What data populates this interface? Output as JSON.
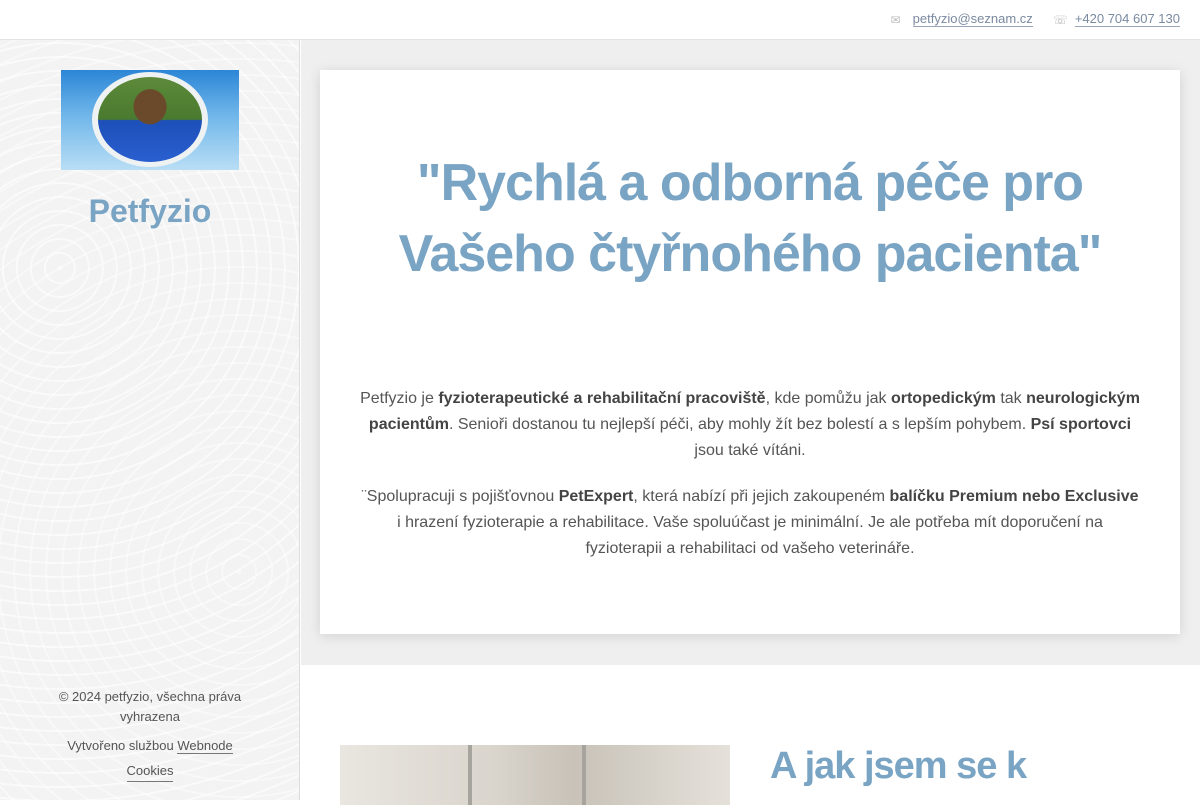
{
  "topbar": {
    "email": "petfyzio@seznam.cz",
    "phone": "+420 704 607 130",
    "email_icon": "envelope-icon",
    "phone_icon": "phone-icon"
  },
  "sidebar": {
    "site_title": "Petfyzio",
    "copyright": "© 2024 petfyzio, všechna práva vyhrazena",
    "made_with_prefix": "Vytvořeno službou",
    "made_with_link": "Webnode",
    "cookies": "Cookies"
  },
  "hero": {
    "headline": "\"Rychlá a odborná péče pro Vašeho čtyřnohého pacienta\""
  },
  "intro": {
    "p1": [
      "Petfyzio je ",
      "fyzioterapeutické a rehabilitační pracoviště",
      ", kde pomůžu jak ",
      "ortopedickým",
      " tak ",
      "neurologickým pacientům",
      ". Senioři dostanou tu nejlepší péči, aby mohly žít bez bolestí a s lepším pohybem. ",
      "Psí sportovci",
      " jsou také vítáni."
    ],
    "p2": [
      "¨Spolupracuji s pojišťovnou ",
      "PetExpert",
      ", která nabízí při jejich zakoupeném ",
      "balíčku Premium nebo Exclusive",
      " i hrazení fyzioterapie a rehabilitace. Vaše spoluúčast je minimální. Je ale potřeba mít doporučení na fyzioterapii a rehabilitaci od vašeho veterináře."
    ]
  },
  "section2": {
    "heading": "A jak jsem se k"
  }
}
